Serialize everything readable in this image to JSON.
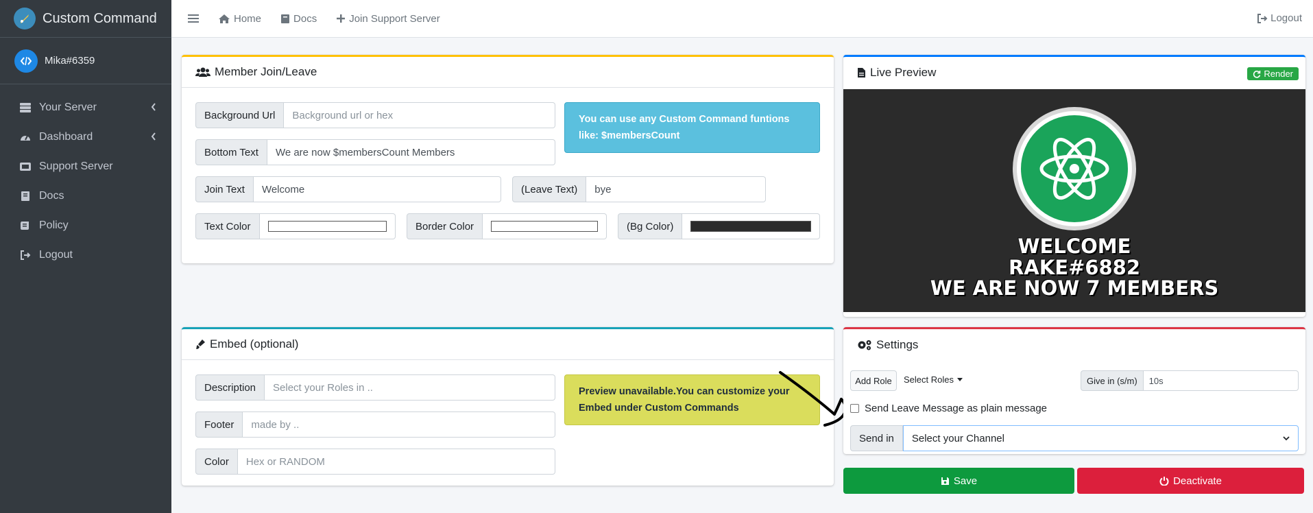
{
  "brand": {
    "title": "Custom Command"
  },
  "user": {
    "name": "Mika#6359"
  },
  "sidebar": {
    "items": [
      {
        "label": "Your Server",
        "icon": "server-icon",
        "chevron": true
      },
      {
        "label": "Dashboard",
        "icon": "dashboard-icon",
        "chevron": true
      },
      {
        "label": "Support Server",
        "icon": "support-icon",
        "chevron": false
      },
      {
        "label": "Docs",
        "icon": "book-icon",
        "chevron": false
      },
      {
        "label": "Policy",
        "icon": "scroll-icon",
        "chevron": false
      },
      {
        "label": "Logout",
        "icon": "logout-icon",
        "chevron": false
      }
    ]
  },
  "topbar": {
    "home": "Home",
    "docs": "Docs",
    "support": "Join Support Server",
    "logout": "Logout"
  },
  "join_leave": {
    "title": "Member Join/Leave",
    "background_label": "Background Url",
    "background_placeholder": "Background url or hex",
    "bottom_label": "Bottom Text",
    "bottom_value": "We are now $membersCount Members",
    "join_label": "Join Text",
    "join_value": "Welcome",
    "leave_label": "(Leave Text)",
    "leave_value": "bye",
    "text_color_label": "Text Color",
    "border_color_label": "Border Color",
    "bg_color_label": "(Bg Color)",
    "text_color": "#ffffff",
    "border_color": "#ffffff",
    "bg_color": "#2b2b2b",
    "info": "You can use any Custom Command funtions like: $membersCount"
  },
  "preview": {
    "title": "Live Preview",
    "render": "Render",
    "line1": "WELCOME",
    "line2": "RAKE#6882",
    "line3": "WE ARE NOW 7 MEMBERS"
  },
  "embed": {
    "title": "Embed (optional)",
    "description_label": "Description",
    "description_placeholder": "Select your Roles in ..",
    "footer_label": "Footer",
    "footer_placeholder": "made by ..",
    "color_label": "Color",
    "color_placeholder": "Hex or RANDOM",
    "notice": "Preview unavailable.You can customize your Embed under Custom Commands"
  },
  "settings": {
    "title": "Settings",
    "add_role": "Add Role",
    "select_roles": "Select Roles",
    "give_in_label": "Give in (s/m)",
    "give_in_value": "10s",
    "plain_message_label": "Send Leave Message as plain message",
    "send_in_label": "Send in",
    "channel_select": "Select your Channel",
    "save": "Save",
    "deactivate": "Deactivate"
  },
  "colors": {
    "sidebar": "#343a40",
    "warning": "#ffc107",
    "primary": "#007bff",
    "info": "#17a2b8",
    "danger": "#dc3545",
    "success": "#28a745"
  }
}
